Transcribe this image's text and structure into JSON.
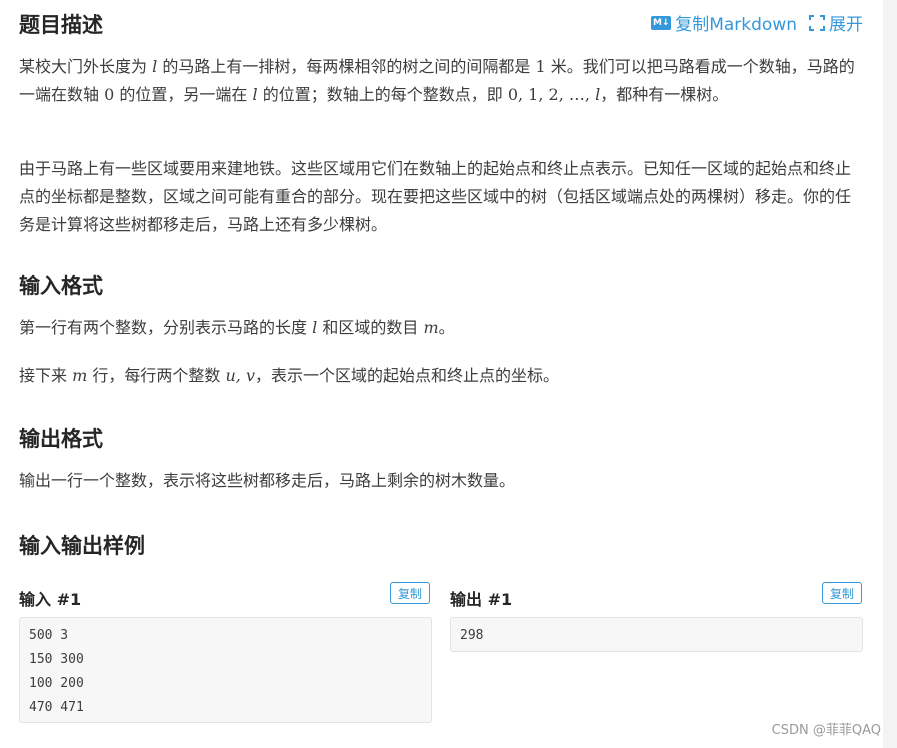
{
  "toolbar": {
    "md_icon": "M↓",
    "copy_markdown": "复制Markdown",
    "expand": "展开"
  },
  "description": {
    "title": "题目描述",
    "p1": {
      "a": "某校大门外长度为",
      "l": "l",
      "b": "的马路上有一排树，每两棵相邻的树之间的间隔都是",
      "one": "1",
      "c": "米。我们可以把马路看成一个数轴，马路的一端在数轴",
      "zero": "0",
      "d": "的位置，另一端在",
      "l2": "l",
      "e": "的位置；数轴上的每个整数点，即",
      "seq": "0, 1, 2, …, ",
      "seq_l": "l",
      "f": "，都种有一棵树。"
    },
    "p2": "由于马路上有一些区域要用来建地铁。这些区域用它们在数轴上的起始点和终止点表示。已知任一区域的起始点和终止点的坐标都是整数，区域之间可能有重合的部分。现在要把这些区域中的树（包括区域端点处的两棵树）移走。你的任务是计算将这些树都移走后，马路上还有多少棵树。"
  },
  "input_format": {
    "title": "输入格式",
    "p1": {
      "a": "第一行有两个整数，分别表示马路的长度",
      "l": "l",
      "b": "和区域的数目",
      "m": "m",
      "c": "。"
    },
    "p2": {
      "a": "接下来",
      "m": "m",
      "b": "行，每行两个整数",
      "uv": "u, v",
      "c": "，表示一个区域的起始点和终止点的坐标。"
    }
  },
  "output_format": {
    "title": "输出格式",
    "p1": "输出一行一个整数，表示将这些树都移走后，马路上剩余的树木数量。"
  },
  "samples": {
    "title": "输入输出样例",
    "input_label": "输入 #1",
    "output_label": "输出 #1",
    "copy_label": "复制",
    "input_lines": [
      "500 3",
      "150 300",
      "100 200",
      "470 471"
    ],
    "output_lines": [
      "298"
    ]
  },
  "watermark": "CSDN @菲菲QAQ",
  "colors": {
    "accent": "#3498db",
    "text": "#3d3d3d",
    "heading": "#262626"
  }
}
